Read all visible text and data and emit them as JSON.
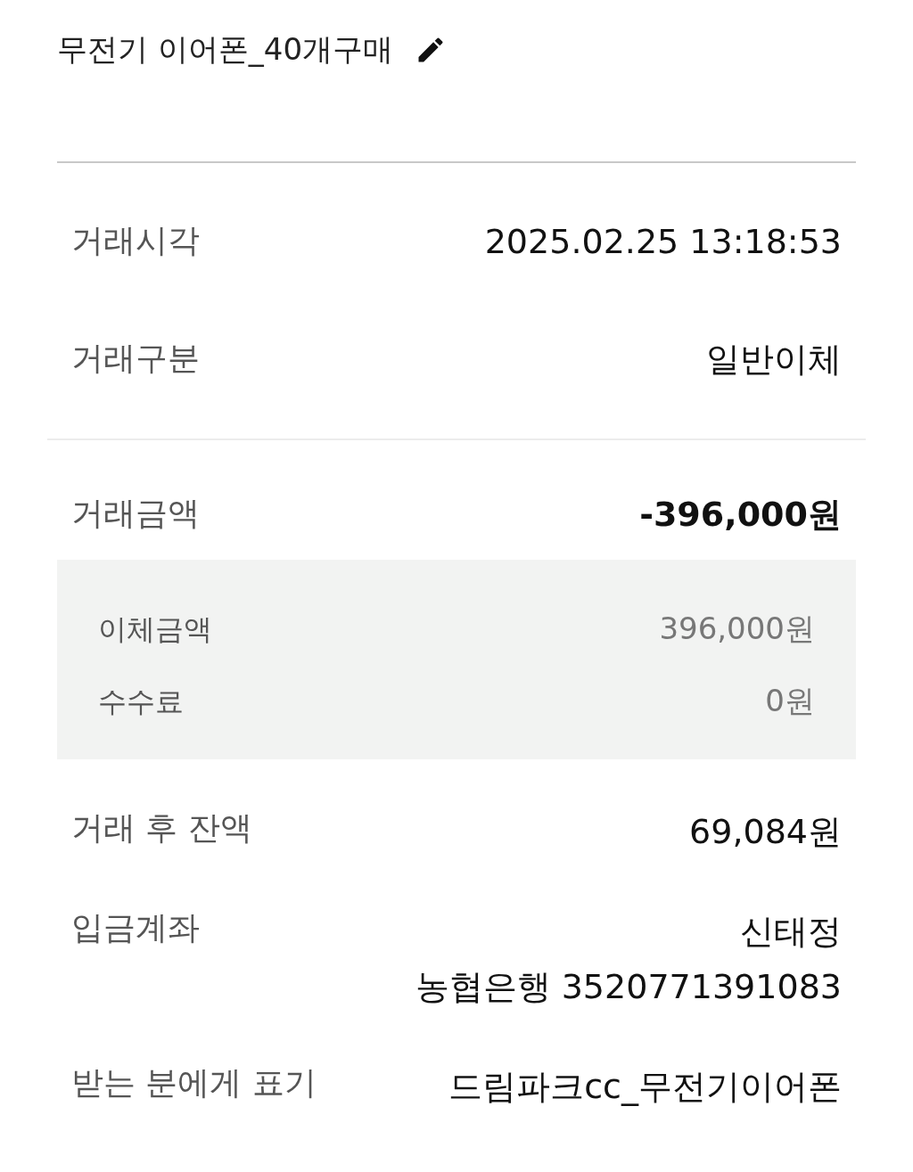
{
  "title": "무전기 이어폰_40개구매",
  "rows_top": [
    {
      "label": "거래시각",
      "value": "2025.02.25 13:18:53"
    },
    {
      "label": "거래구분",
      "value": "일반이체"
    }
  ],
  "amount": {
    "label": "거래금액",
    "value": "-396,000원"
  },
  "breakdown": [
    {
      "label": "이체금액",
      "value": "396,000원"
    },
    {
      "label": "수수료",
      "value": "0원"
    }
  ],
  "rows_bottom": [
    {
      "label": "거래 후 잔액",
      "lines": [
        "69,084원"
      ]
    },
    {
      "label": "입금계좌",
      "lines": [
        "신태정",
        "농협은행 3520771391083"
      ]
    },
    {
      "label": "받는 분에게 표기",
      "lines": [
        "드림파크cc_무전기이어폰"
      ]
    }
  ]
}
